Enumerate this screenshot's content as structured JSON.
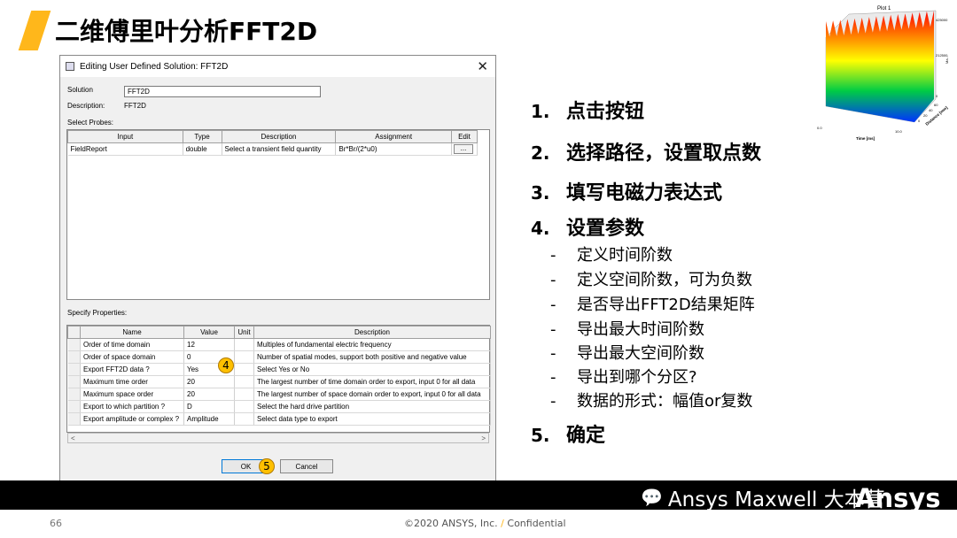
{
  "title": "二维傅里叶分析FFT2D",
  "dialog": {
    "title": "Editing User Defined Solution: FFT2D",
    "solution_label": "Solution",
    "solution_value": "FFT2D",
    "description_label": "Description:",
    "description_value": "FFT2D",
    "probes_label": "Select Probes:",
    "probe_columns": [
      "Input",
      "Type",
      "Description",
      "Assignment",
      "Edit"
    ],
    "probe_row": {
      "input": "FieldReport",
      "type": "double",
      "description": "Select a transient field quantity",
      "assignment": "Br*Br/(2*u0)",
      "edit": "..."
    },
    "props_label": "Specify Properties:",
    "prop_columns": [
      "Name",
      "Value",
      "Unit",
      "Description"
    ],
    "props": [
      {
        "name": "Order of time domain",
        "value": "12",
        "unit": "",
        "desc": "Multiples of fundamental electric frequency"
      },
      {
        "name": "Order of space domain",
        "value": "0",
        "unit": "",
        "desc": "Number of spatial modes, support both positive and negative value"
      },
      {
        "name": "Export FFT2D data ?",
        "value": "Yes",
        "unit": "",
        "desc": "Select Yes or No"
      },
      {
        "name": "Maximum time order",
        "value": "20",
        "unit": "",
        "desc": "The largest number of time domain order to export, input 0 for all data"
      },
      {
        "name": "Maximum space order",
        "value": "20",
        "unit": "",
        "desc": "The largest number of space domain order to export, input 0 for all data"
      },
      {
        "name": "Export to which partition ?",
        "value": "D",
        "unit": "",
        "desc": "Select the hard drive partition"
      },
      {
        "name": "Export amplitude or complex ?",
        "value": "Amplitude",
        "unit": "",
        "desc": "Select data type to export"
      }
    ],
    "scroll_left": "<",
    "scroll_right": ">",
    "ok_label": "OK",
    "cancel_label": "Cancel",
    "close_glyph": "✕"
  },
  "badges": {
    "four": "4",
    "five": "5"
  },
  "steps": [
    {
      "num": "1.",
      "text": "点击按钮"
    },
    {
      "num": "2.",
      "text": "选择路径，设置取点数"
    },
    {
      "num": "3.",
      "text": "填写电磁力表达式"
    },
    {
      "num": "4.",
      "text": "设置参数"
    },
    {
      "num": "5.",
      "text": "确定"
    }
  ],
  "substeps": [
    {
      "dash": "-",
      "text": "定义时间阶数"
    },
    {
      "dash": "-",
      "text": "定义空间阶数，可为负数"
    },
    {
      "dash": "-",
      "text": "是否导出FFT2D结果矩阵"
    },
    {
      "dash": "-",
      "text": "导出最大时间阶数"
    },
    {
      "dash": "-",
      "text": "导出最大空间阶数"
    },
    {
      "dash": "-",
      "text": "导出到哪个分区?"
    },
    {
      "dash": "-",
      "text": "数据的形式：幅值or复数"
    }
  ],
  "plot": {
    "title": "Plot 1",
    "xlabel": "Time [ms]",
    "ylabel": "Distance [mm]",
    "zlabel": "Ma...",
    "z_ticks": [
      "425000",
      "212500",
      "0"
    ],
    "x_ticks": [
      "0.0",
      "10.0"
    ],
    "y_ticks": [
      "0",
      "20",
      "40",
      "60"
    ],
    "colors": {
      "high": "#ff0000",
      "mid1": "#ffff00",
      "mid2": "#00cc44",
      "low": "#0033ff"
    }
  },
  "footer": {
    "wechat_icon": "💬",
    "wechat_text": "Ansys Maxwell 大本营",
    "logo": "Ansys",
    "page_number": "66",
    "copyright_main": "©2020 ANSYS, Inc.",
    "copyright_sep": " / ",
    "copyright_tail": "Confidential"
  },
  "colors": {
    "accent": "#ffb71b",
    "badge": "#ffc000"
  }
}
